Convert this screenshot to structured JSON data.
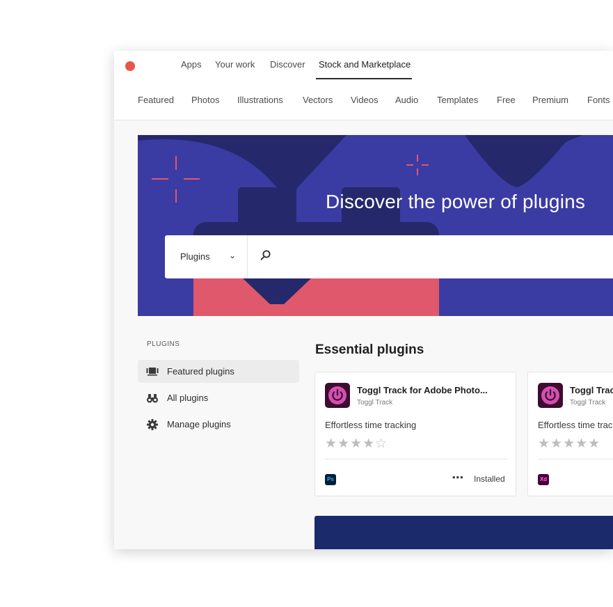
{
  "top_nav": {
    "items": [
      "Apps",
      "Your work",
      "Discover",
      "Stock and Marketplace"
    ],
    "active": "Stock and Marketplace"
  },
  "categories": [
    "Featured",
    "Photos",
    "Illustrations",
    "Vectors",
    "Videos",
    "Audio",
    "Templates",
    "Free",
    "Premium",
    "Fonts"
  ],
  "hero": {
    "title": "Discover the power of plugins",
    "search_scope": "Plugins",
    "search_placeholder": ""
  },
  "sidebar": {
    "heading": "PLUGINS",
    "items": [
      {
        "label": "Featured plugins",
        "icon": "featured-icon",
        "active": true
      },
      {
        "label": "All plugins",
        "icon": "binoculars-icon",
        "active": false
      },
      {
        "label": "Manage plugins",
        "icon": "gear-icon",
        "active": false
      }
    ]
  },
  "section": {
    "title": "Essential plugins"
  },
  "cards": [
    {
      "title": "Toggl Track for Adobe Photo...",
      "developer": "Toggl Track",
      "description": "Effortless time tracking",
      "stars": "★★★★☆",
      "rating": 4,
      "app": "Ps",
      "more": "•••",
      "status": "Installed"
    },
    {
      "title": "Toggl Trac",
      "developer": "Toggl Track",
      "description": "Effortless time trac",
      "stars": "★★★★★",
      "rating": 5,
      "app": "Xd",
      "more": "",
      "status": ""
    }
  ],
  "colors": {
    "accent_red": "#e8554a",
    "hero_purple": "#3b3ba4",
    "hero_navy": "#25296b",
    "hero_pink": "#e0586b",
    "plugin_pink": "#d44fb2",
    "ps_blue": "#001e36",
    "xd_purple": "#470137",
    "banner_navy": "#1b2a6b"
  }
}
